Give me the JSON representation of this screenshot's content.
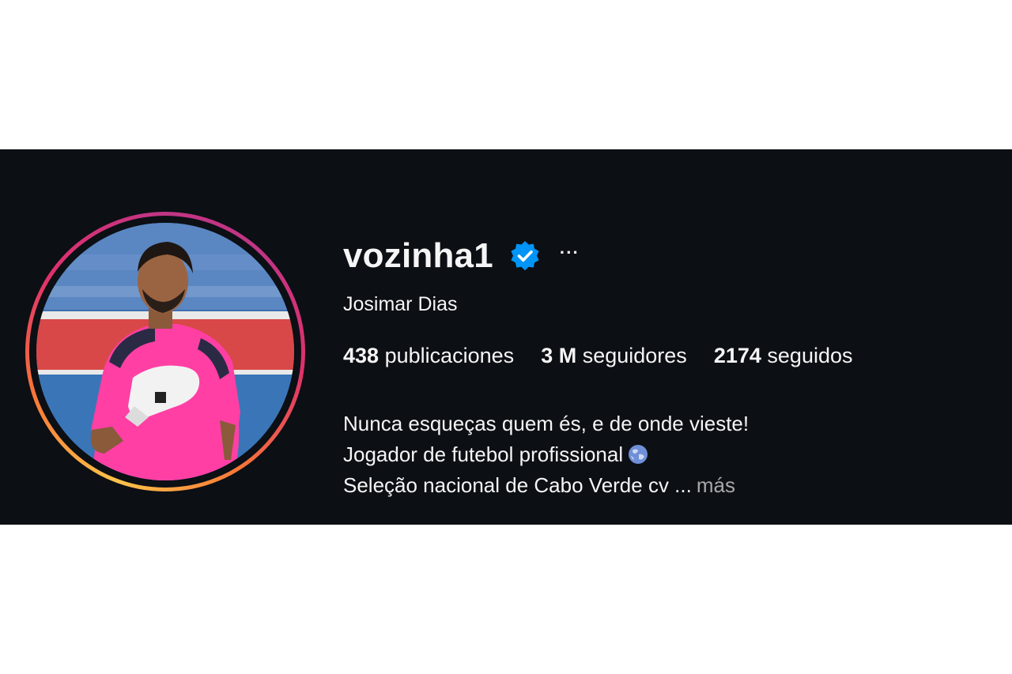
{
  "profile": {
    "username": "vozinha1",
    "verified": true,
    "full_name": "Josimar Dias",
    "more_label": "···",
    "stats": {
      "posts_value": "438",
      "posts_label": "publicaciones",
      "followers_value": "3 M",
      "followers_label": "seguidores",
      "following_value": "2174",
      "following_label": "seguidos"
    },
    "bio": {
      "line1": "Nunca esqueças quem és, e de onde vieste!",
      "line2": "Jogador de futebol profissional",
      "line3": "Seleção nacional de Cabo Verde cv ...",
      "more_link": "más"
    }
  },
  "icons": {
    "verified": "verified-badge-icon",
    "more": "more-options-icon",
    "globe": "globe-emoji-icon"
  },
  "colors": {
    "background": "#0c0f14",
    "page": "#ffffff",
    "text": "#f5f5f5",
    "muted": "#a8a8a8",
    "verified": "#0095f6",
    "ring_start": "#fdc34a",
    "ring_end": "#c13584"
  }
}
